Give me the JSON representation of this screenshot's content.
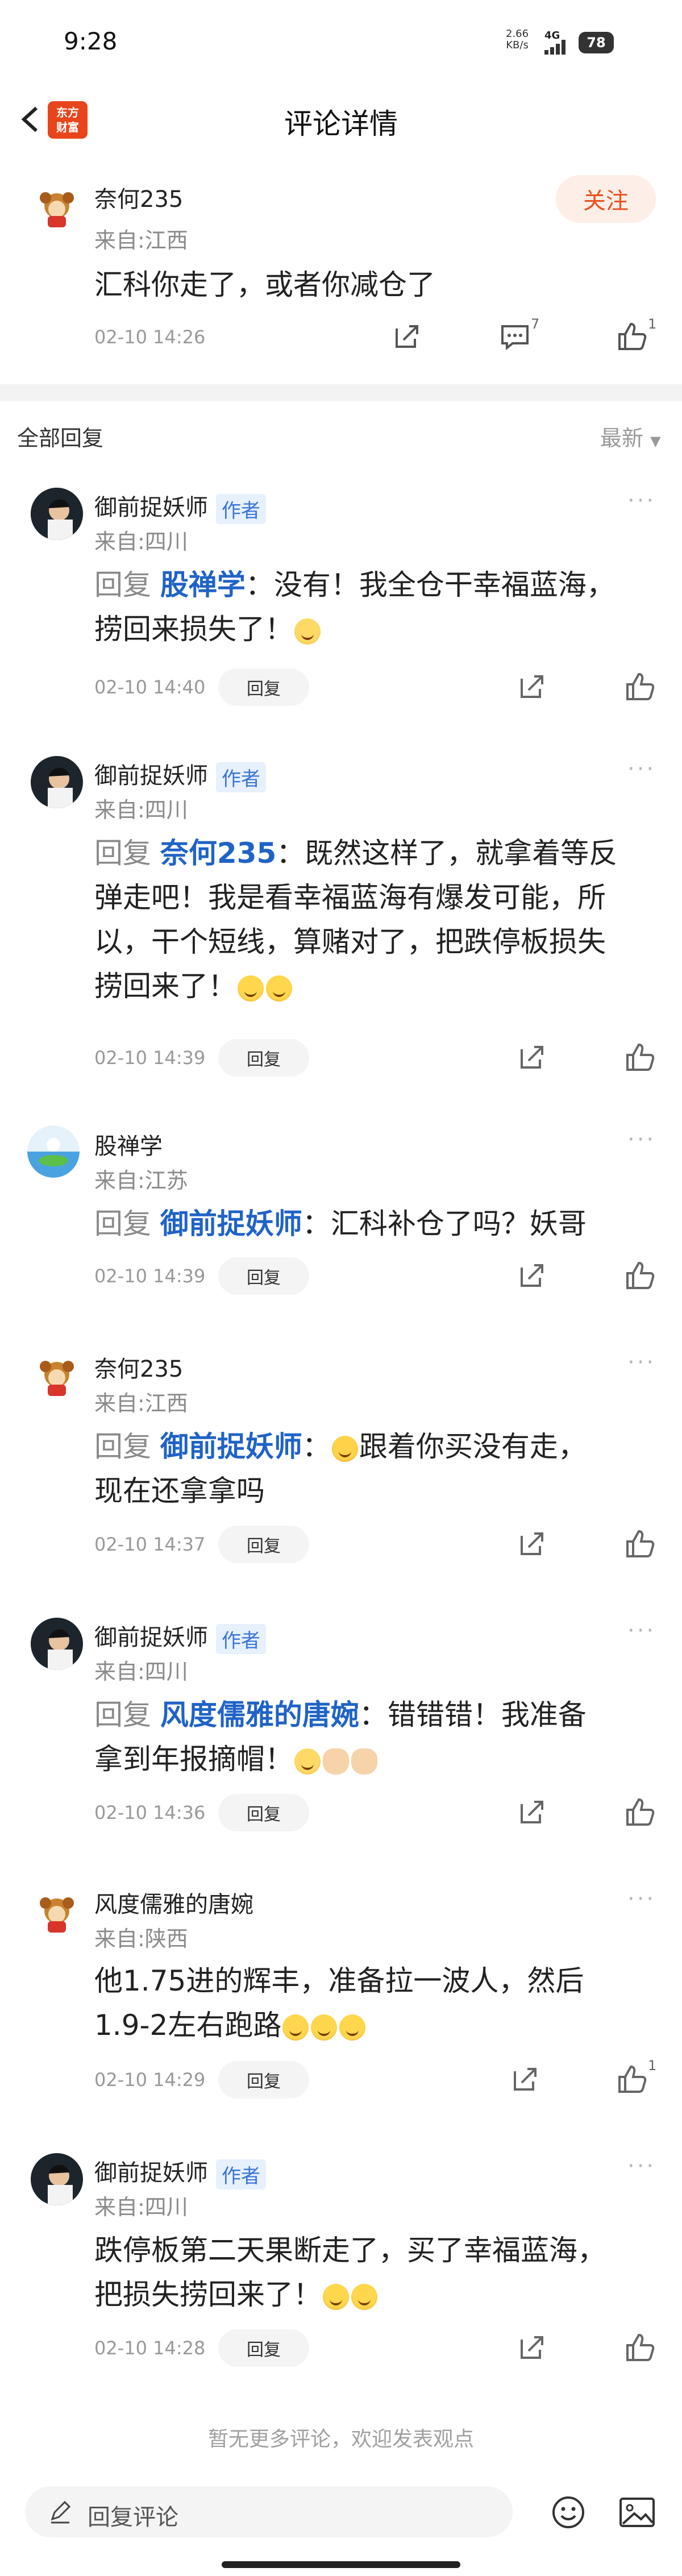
{
  "status_bar": {
    "time": "9:28",
    "speed_value": "2.66",
    "speed_unit": "KB/s",
    "network": "4G",
    "battery": "78"
  },
  "header": {
    "title": "评论详情",
    "logo_text": "东方\n财富"
  },
  "main_comment": {
    "user": "奈何235",
    "location": "来自:江西",
    "text": "汇科你走了，或者你减仓了",
    "time": "02-10 14:26",
    "follow_label": "关注",
    "comment_count": "7",
    "like_count": "1"
  },
  "replies_header": {
    "label": "全部回复",
    "sort_label": "最新"
  },
  "replies": [
    {
      "user": "御前捉妖师",
      "author_tag": "作者",
      "location": "来自:四川",
      "prefix": "回复 ",
      "target": "股禅学",
      "line1": "：没有！我全仓干幸福蓝海，",
      "line2": "捞回来损失了！",
      "line3": "",
      "time": "02-10 14:40",
      "reply_label": "回复"
    },
    {
      "user": "御前捉妖师",
      "author_tag": "作者",
      "location": "来自:四川",
      "prefix": "回复 ",
      "target": "奈何235",
      "line1": "：既然这样了，就拿着等反",
      "line2": "弹走吧！我是看幸福蓝海有爆发可能，所",
      "line3": "以，干个短线，算赌对了，把跌停板损失",
      "line4": "捞回来了！",
      "time": "02-10 14:39",
      "reply_label": "回复"
    },
    {
      "user": "股禅学",
      "author_tag": "",
      "location": "来自:江苏",
      "prefix": "回复 ",
      "target": "御前捉妖师",
      "line1": "：汇科补仓了吗？妖哥",
      "time": "02-10 14:39",
      "reply_label": "回复"
    },
    {
      "user": "奈何235",
      "author_tag": "",
      "location": "来自:江西",
      "prefix": "回复 ",
      "target": "御前捉妖师",
      "line1": "：",
      "line1b": "跟着你买没有走，",
      "line2": "现在还拿拿吗",
      "time": "02-10 14:37",
      "reply_label": "回复"
    },
    {
      "user": "御前捉妖师",
      "author_tag": "作者",
      "location": "来自:四川",
      "prefix": "回复 ",
      "target": "风度儒雅的唐婉",
      "line1": "：错错错！我准备",
      "line2": "拿到年报摘帽！",
      "time": "02-10 14:36",
      "reply_label": "回复"
    },
    {
      "user": "风度儒雅的唐婉",
      "author_tag": "",
      "location": "来自:陕西",
      "line1": "他1.75进的辉丰，准备拉一波人，然后",
      "line2": "1.9-2左右跑路",
      "time": "02-10 14:29",
      "reply_label": "回复",
      "like_count": "1"
    },
    {
      "user": "御前捉妖师",
      "author_tag": "作者",
      "location": "来自:四川",
      "line1": "跌停板第二天果断走了，买了幸福蓝海，",
      "line2": "把损失捞回来了！",
      "time": "02-10 14:28",
      "reply_label": "回复"
    }
  ],
  "footer": {
    "no_more": "暂无更多评论，欢迎发表观点",
    "input_placeholder": "回复评论"
  },
  "colors": {
    "accent": "#1f63c7",
    "brand": "#e8451c",
    "follow_bg": "#fdeee7"
  }
}
